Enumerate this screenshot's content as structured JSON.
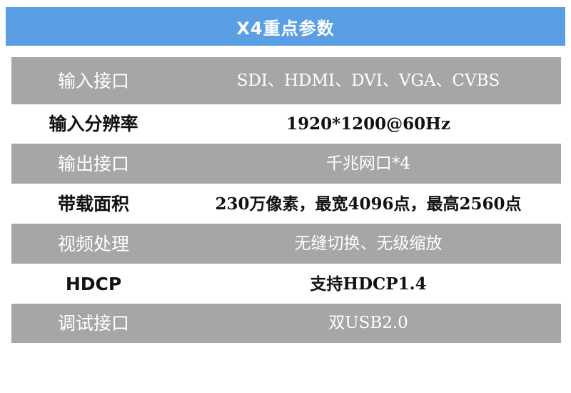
{
  "title": "X4重点参数",
  "rows": [
    {
      "label": "输入接口",
      "value_lines": [
        "SDI、HDMI、DVI、",
        "VGA、CVBS"
      ],
      "shaded": true
    },
    {
      "label": "输入分辨率",
      "value_lines": [
        "1920*1200@60Hz"
      ],
      "shaded": false
    },
    {
      "label": "输出接口",
      "value_lines": [
        "千兆网口*4"
      ],
      "shaded": true
    },
    {
      "label": "带载面积",
      "value_lines": [
        "230万像素，最宽4096点，",
        "最高2560点"
      ],
      "shaded": false
    },
    {
      "label": "视频处理",
      "value_lines": [
        "无缝切换、无级缩放"
      ],
      "shaded": true
    },
    {
      "label": "HDCP",
      "value_lines": [
        "支持HDCP1.4"
      ],
      "shaded": false
    },
    {
      "label": "调试接口",
      "value_lines": [
        "双USB2.0"
      ],
      "shaded": true
    }
  ],
  "colors": {
    "title_bg": "#5a9fe3",
    "shaded_row": "#a6a6a6",
    "plain_row": "#ffffff"
  }
}
